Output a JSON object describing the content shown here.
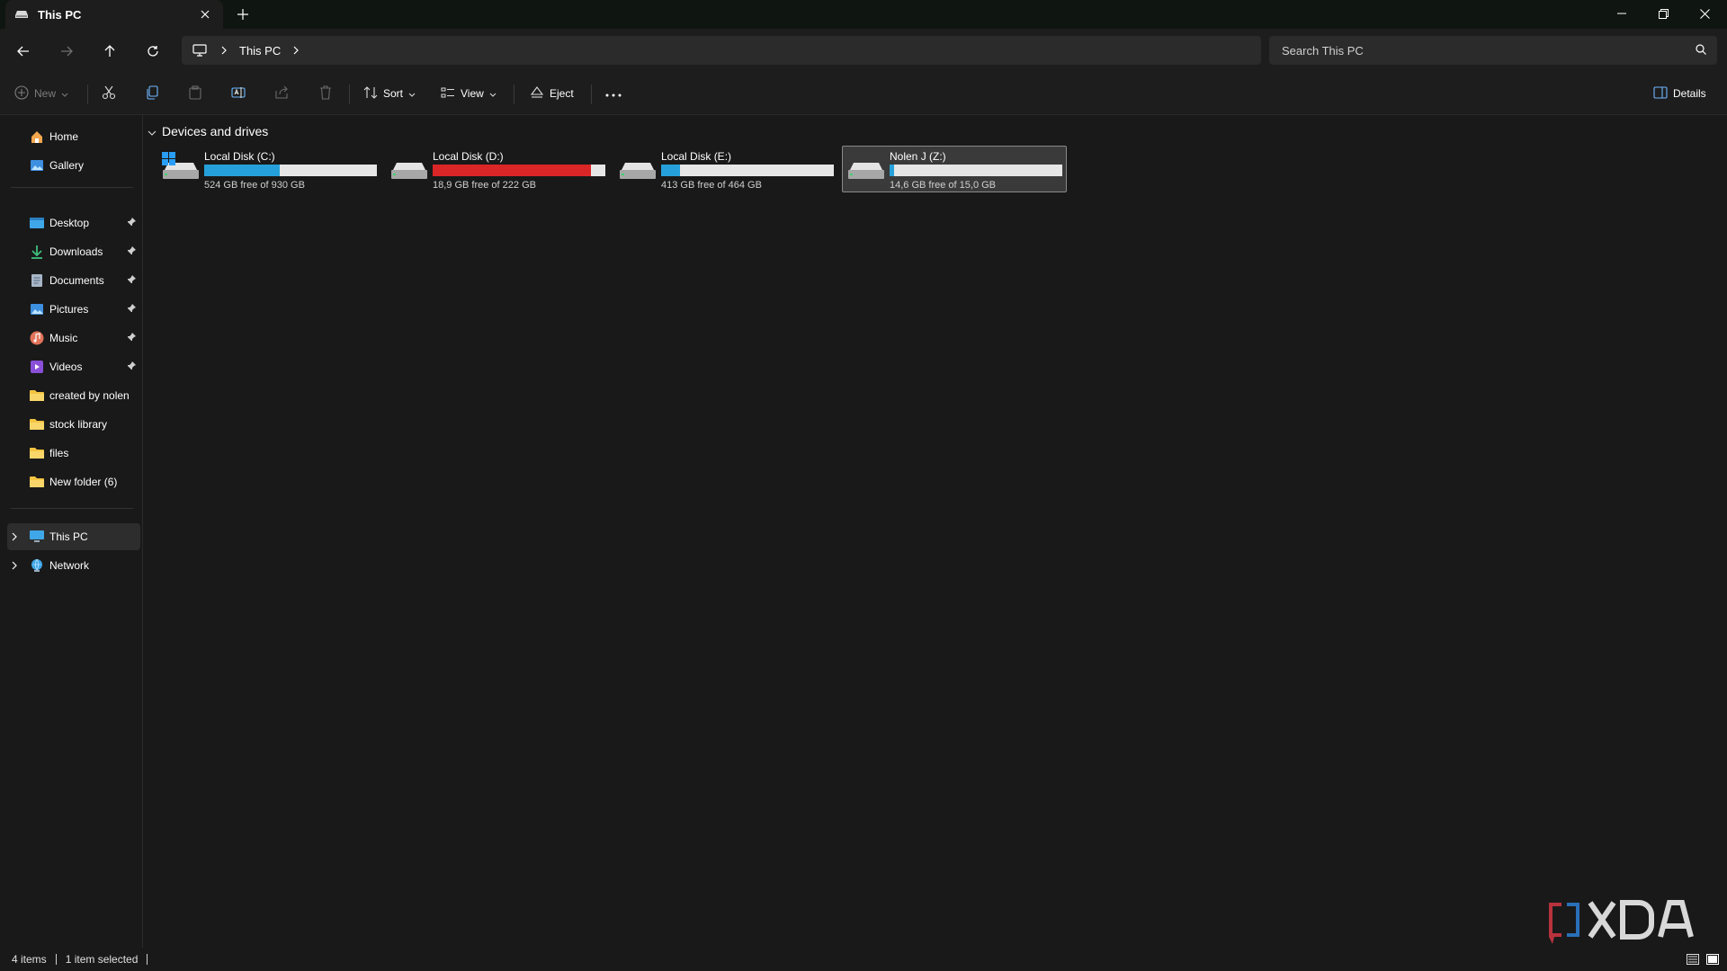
{
  "window": {
    "tab_title": "This PC",
    "tab_icon": "drive-icon"
  },
  "address": {
    "breadcrumbs": [
      "This PC"
    ],
    "search_placeholder": "Search This PC"
  },
  "commands": {
    "new": "New",
    "sort": "Sort",
    "view": "View",
    "eject": "Eject",
    "details": "Details"
  },
  "sidebar": {
    "top": [
      {
        "label": "Home",
        "icon": "home-icon"
      },
      {
        "label": "Gallery",
        "icon": "gallery-icon"
      }
    ],
    "quick_access": [
      {
        "label": "Desktop",
        "icon": "desktop-folder-icon",
        "pinned": true
      },
      {
        "label": "Downloads",
        "icon": "downloads-icon",
        "pinned": true
      },
      {
        "label": "Documents",
        "icon": "documents-icon",
        "pinned": true
      },
      {
        "label": "Pictures",
        "icon": "pictures-icon",
        "pinned": true
      },
      {
        "label": "Music",
        "icon": "music-icon",
        "pinned": true
      },
      {
        "label": "Videos",
        "icon": "videos-icon",
        "pinned": true
      },
      {
        "label": "created by nolen",
        "icon": "folder-icon",
        "pinned": false
      },
      {
        "label": "stock library",
        "icon": "folder-icon",
        "pinned": false
      },
      {
        "label": "files",
        "icon": "folder-icon",
        "pinned": false
      },
      {
        "label": "New folder (6)",
        "icon": "folder-icon",
        "pinned": false
      }
    ],
    "locations": [
      {
        "label": "This PC",
        "icon": "this-pc-icon",
        "selected": true
      },
      {
        "label": "Network",
        "icon": "network-icon",
        "selected": false
      }
    ]
  },
  "content": {
    "group_title": "Devices and drives",
    "drives": [
      {
        "name": "Local Disk (C:)",
        "free_text": "524 GB free of 930 GB",
        "used_fraction": 0.437,
        "bar_color": "#26a0da",
        "selected": false,
        "system": true
      },
      {
        "name": "Local Disk (D:)",
        "free_text": "18,9 GB free of 222 GB",
        "used_fraction": 0.915,
        "bar_color": "#da2626",
        "selected": false,
        "system": false
      },
      {
        "name": "Local Disk (E:)",
        "free_text": "413 GB free of 464 GB",
        "used_fraction": 0.11,
        "bar_color": "#26a0da",
        "selected": false,
        "system": false
      },
      {
        "name": "Nolen J (Z:)",
        "free_text": "14,6 GB free of 15,0 GB",
        "used_fraction": 0.027,
        "bar_color": "#26a0da",
        "selected": true,
        "system": false
      }
    ]
  },
  "status": {
    "item_count": "4 items",
    "selection": "1 item selected"
  },
  "colors": {
    "accent": "#26a0da",
    "warning": "#da2626",
    "folder": "#f4c542"
  }
}
